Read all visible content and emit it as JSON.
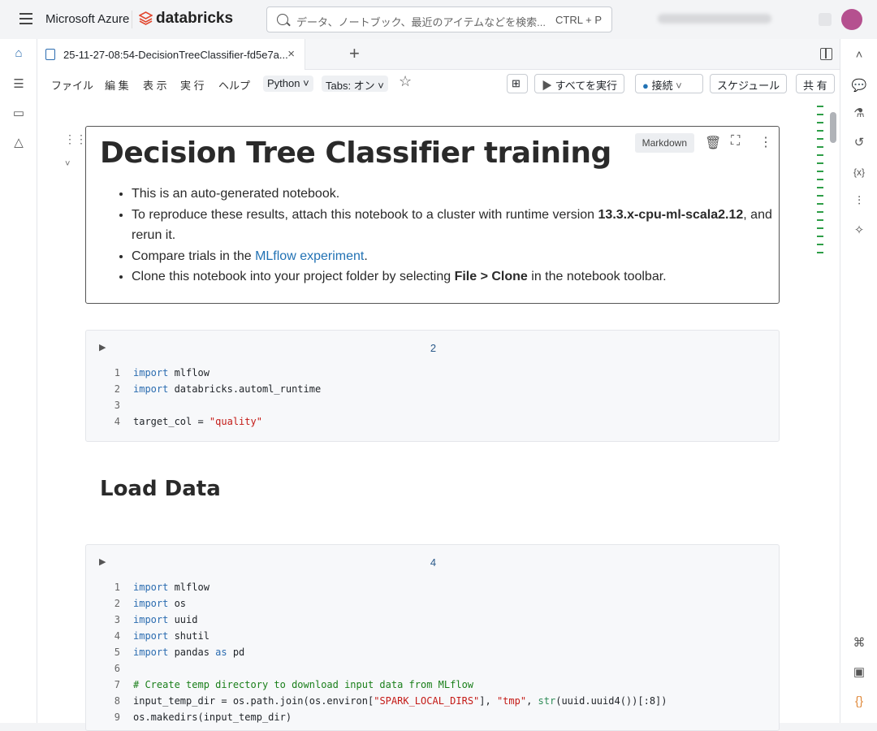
{
  "topbar": {
    "brand": "Microsoft Azure",
    "product": "databricks",
    "search_placeholder": "データ、ノートブック、最近のアイテムなどを検索...",
    "search_shortcut": "CTRL + P"
  },
  "tab": {
    "title": "25-11-27-08:54-DecisionTreeClassifier-fd5e7a..."
  },
  "menu": {
    "file": "ファイル",
    "edit": "編 集",
    "view": "表 示",
    "run": "実 行",
    "help": "ヘルプ",
    "language": "Python",
    "tabs": "Tabs: オン"
  },
  "toolbar": {
    "run_all": "すべてを実行",
    "connect": "接続",
    "schedule": "スケジュール",
    "share": "共 有"
  },
  "markdown_cell": {
    "tag": "Markdown",
    "title": "Decision Tree Classifier training",
    "b1": "This is an auto-generated notebook.",
    "b2a": "To reproduce these results, attach this notebook to a cluster with runtime version ",
    "b2b": "13.3.x-cpu-ml-scala2.12",
    "b2c": ", and rerun it.",
    "b3a": "Compare trials in the ",
    "b3link": "MLflow experiment",
    "b3b": ".",
    "b4a": "Clone this notebook into your project folder by selecting ",
    "b4b": "File > Clone",
    "b4c": " in the notebook toolbar."
  },
  "cell2": {
    "number": "2",
    "lines": [
      [
        [
          "import",
          "k"
        ],
        [
          " mlflow",
          ""
        ]
      ],
      [
        [
          "import",
          "k"
        ],
        [
          " databricks.automl_runtime",
          ""
        ]
      ],
      [],
      [
        [
          "target_col = ",
          ""
        ],
        [
          "\"quality\"",
          "s"
        ]
      ]
    ]
  },
  "heading": "Load Data",
  "cell4": {
    "number": "4",
    "lines": [
      [
        [
          "import",
          "k"
        ],
        [
          " mlflow",
          ""
        ]
      ],
      [
        [
          "import",
          "k"
        ],
        [
          " os",
          ""
        ]
      ],
      [
        [
          "import",
          "k"
        ],
        [
          " uuid",
          ""
        ]
      ],
      [
        [
          "import",
          "k"
        ],
        [
          " shutil",
          ""
        ]
      ],
      [
        [
          "import",
          "k"
        ],
        [
          " pandas ",
          ""
        ],
        [
          "as",
          "k"
        ],
        [
          " pd",
          ""
        ]
      ],
      [],
      [
        [
          "# Create temp directory to download input data from MLflow",
          "c"
        ]
      ],
      [
        [
          "input_temp_dir = os.path.join(os.environ[",
          ""
        ],
        [
          "\"SPARK_LOCAL_DIRS\"",
          "s"
        ],
        [
          "], ",
          ""
        ],
        [
          "\"tmp\"",
          "s"
        ],
        [
          ", ",
          ""
        ],
        [
          "str",
          "b"
        ],
        [
          "(uuid.uuid4())[:8])",
          ""
        ]
      ],
      [
        [
          "os.makedirs(input_temp_dir)",
          ""
        ]
      ]
    ]
  }
}
